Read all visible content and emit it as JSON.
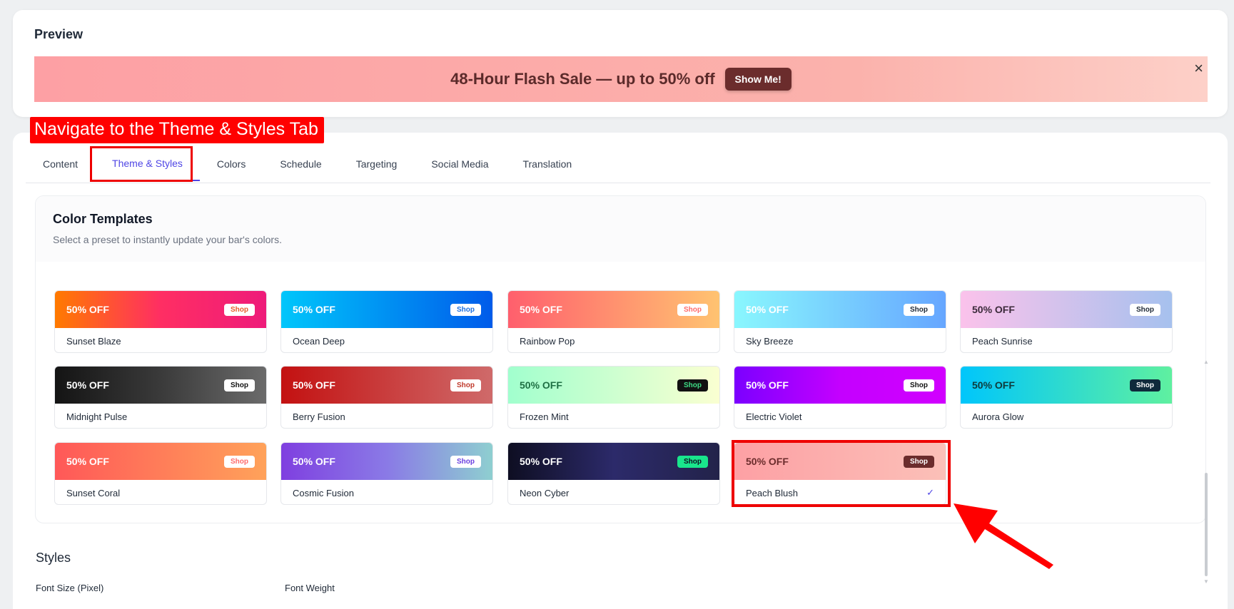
{
  "preview": {
    "title": "Preview",
    "bar_text": "48-Hour Flash Sale — up to 50% off",
    "bar_button": "Show Me!",
    "close_icon": "×"
  },
  "annotation": {
    "label": "Navigate to the Theme & Styles Tab",
    "color": "#ff0000"
  },
  "tabs": [
    {
      "label": "Content"
    },
    {
      "label": "Theme & Styles",
      "active": true
    },
    {
      "label": "Colors"
    },
    {
      "label": "Schedule"
    },
    {
      "label": "Targeting"
    },
    {
      "label": "Social Media"
    },
    {
      "label": "Translation"
    }
  ],
  "templates": {
    "title": "Color Templates",
    "subtitle": "Select a preset to instantly update your bar's colors.",
    "badge_text": "50% OFF",
    "shop_text": "Shop",
    "selected_icon": "✓",
    "items": [
      {
        "name": "Sunset Blaze",
        "bg": "linear-gradient(90deg,#ff7a00,#ff2e63,#ee1b7a)",
        "off": "#ffffff",
        "shopBg": "#ffffff",
        "shopFg": "#e85d2a"
      },
      {
        "name": "Ocean Deep",
        "bg": "linear-gradient(90deg,#00c6fb,#005bea)",
        "off": "#ffffff",
        "shopBg": "#ffffff",
        "shopFg": "#1b6fe0"
      },
      {
        "name": "Rainbow Pop",
        "bg": "linear-gradient(90deg,#ff5f6d,#ffc371)",
        "off": "#ffffff",
        "shopBg": "#ffffff",
        "shopFg": "#ff6b6b"
      },
      {
        "name": "Sky Breeze",
        "bg": "linear-gradient(90deg,#89f7fe,#66a6ff)",
        "off": "#ffffff",
        "shopBg": "#ffffff",
        "shopFg": "#1f2937"
      },
      {
        "name": "Peach Sunrise",
        "bg": "linear-gradient(90deg,#fbc2eb,#a6c1ee)",
        "off": "#3b2a3a",
        "shopBg": "#ffffff",
        "shopFg": "#1f2937"
      },
      {
        "name": "Midnight Pulse",
        "bg": "linear-gradient(90deg,#141414,#3a3a3a,#6b6b6b)",
        "off": "#ffffff",
        "shopBg": "#ffffff",
        "shopFg": "#111111"
      },
      {
        "name": "Berry Fusion",
        "bg": "linear-gradient(90deg,#c31111,#cf6a6a)",
        "off": "#ffffff",
        "shopBg": "#ffffff",
        "shopFg": "#c0392b"
      },
      {
        "name": "Frozen Mint",
        "bg": "linear-gradient(90deg,#a1ffce,#faffd1)",
        "off": "#1f6f44",
        "shopBg": "#111111",
        "shopFg": "#3ddc84"
      },
      {
        "name": "Electric Violet",
        "bg": "linear-gradient(90deg,#7b00ff,#c400ff,#d100ff)",
        "off": "#ffffff",
        "shopBg": "#ffffff",
        "shopFg": "#111111"
      },
      {
        "name": "Aurora Glow",
        "bg": "linear-gradient(90deg,#00c6fb,#5ff0a0)",
        "off": "#0f3b3b",
        "shopBg": "#0f2a3b",
        "shopFg": "#ffffff"
      },
      {
        "name": "Sunset Coral",
        "bg": "linear-gradient(90deg,#ff5858,#ffa25a)",
        "off": "#ffffff",
        "shopBg": "#ffffff",
        "shopFg": "#ff6b6b"
      },
      {
        "name": "Cosmic Fusion",
        "bg": "linear-gradient(90deg,#7f3fe0,#8a7ae6,#8ecfd0)",
        "off": "#ffffff",
        "shopBg": "#ffffff",
        "shopFg": "#6a3fe0"
      },
      {
        "name": "Neon Cyber",
        "bg": "linear-gradient(90deg,#0e0e22,#2c2a6a,#23234a)",
        "off": "#ffffff",
        "shopBg": "#19e68c",
        "shopFg": "#0e0e22"
      },
      {
        "name": "Peach Blush",
        "bg": "linear-gradient(90deg,#fda0a4,#fbc0b8)",
        "off": "#6b2c2c",
        "shopBg": "#6b2c2c",
        "shopFg": "#ffffff",
        "selected": true
      }
    ]
  },
  "styles": {
    "title": "Styles",
    "font_size_label": "Font Size (Pixel)",
    "font_weight_label": "Font Weight"
  }
}
